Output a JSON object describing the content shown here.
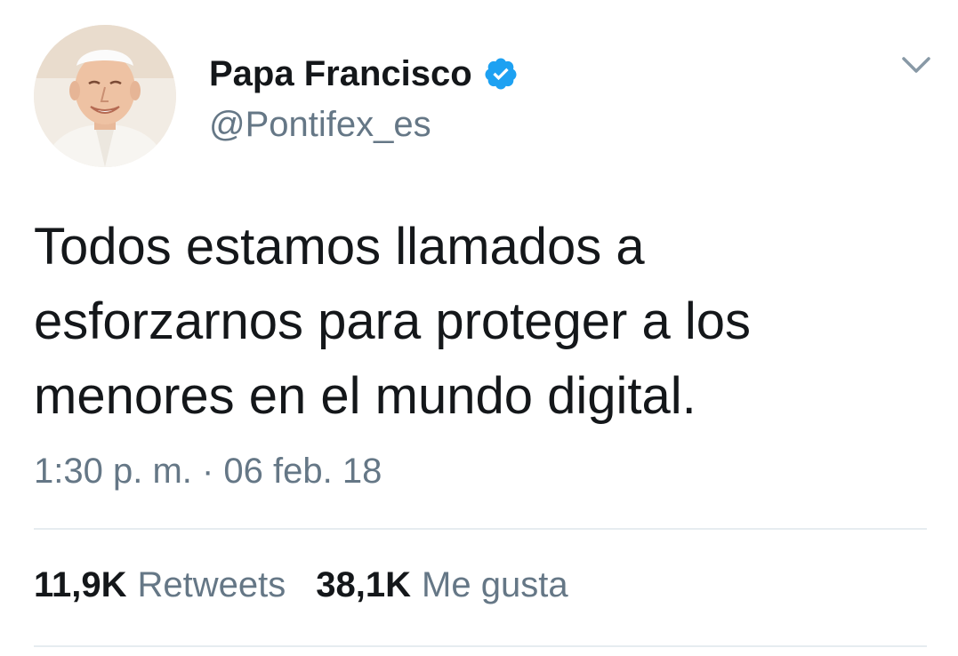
{
  "user": {
    "display_name": "Papa Francisco",
    "handle": "@Pontifex_es",
    "verified": true
  },
  "tweet": {
    "text_lines": [
      "Todos estamos llamados a",
      "esforzarnos para proteger a los",
      "menores en el mundo digital."
    ],
    "timestamp": "1:30 p. m. · 06 feb. 18"
  },
  "stats": {
    "retweets": {
      "count": "11,9K",
      "label": "Retweets"
    },
    "likes": {
      "count": "38,1K",
      "label": "Me gusta"
    }
  },
  "icons": {
    "verified": "verified-badge-icon",
    "menu": "chevron-down-icon"
  },
  "colors": {
    "verified_blue": "#1da1f2",
    "text_primary": "#14171a",
    "text_secondary": "#657786",
    "divider": "#e6ecf0"
  }
}
